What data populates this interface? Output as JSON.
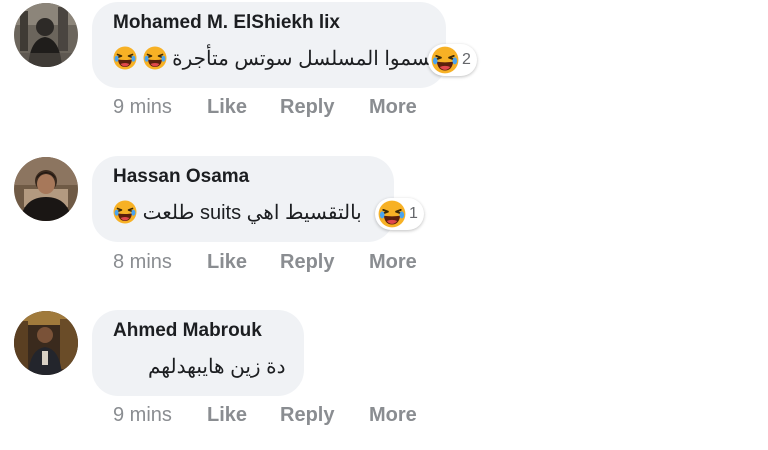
{
  "comments": [
    {
      "author": "Mohamed M. ElShiekh lix",
      "text": "يسموا المسلسل سوتس متأجرة",
      "reaction_count": "2",
      "time": "9 mins",
      "like": "Like",
      "reply": "Reply",
      "more": "More"
    },
    {
      "author": "Hassan Osama",
      "text": "طلعت suits بالتقسيط اهي",
      "reaction_count": "1",
      "time": "8 mins",
      "like": "Like",
      "reply": "Reply",
      "more": "More"
    },
    {
      "author": "Ahmed Mabrouk",
      "text": "دة زين هايبهدلهم",
      "time": "9 mins",
      "like": "Like",
      "reply": "Reply",
      "more": "More"
    }
  ],
  "icons": {
    "reaction": "laughing-emoji-icon",
    "inline": "laughing-emoji-icon"
  },
  "colors": {
    "bubble": "#f0f2f5",
    "action_text": "#8a8d91",
    "emoji_face": "#f7b125"
  }
}
